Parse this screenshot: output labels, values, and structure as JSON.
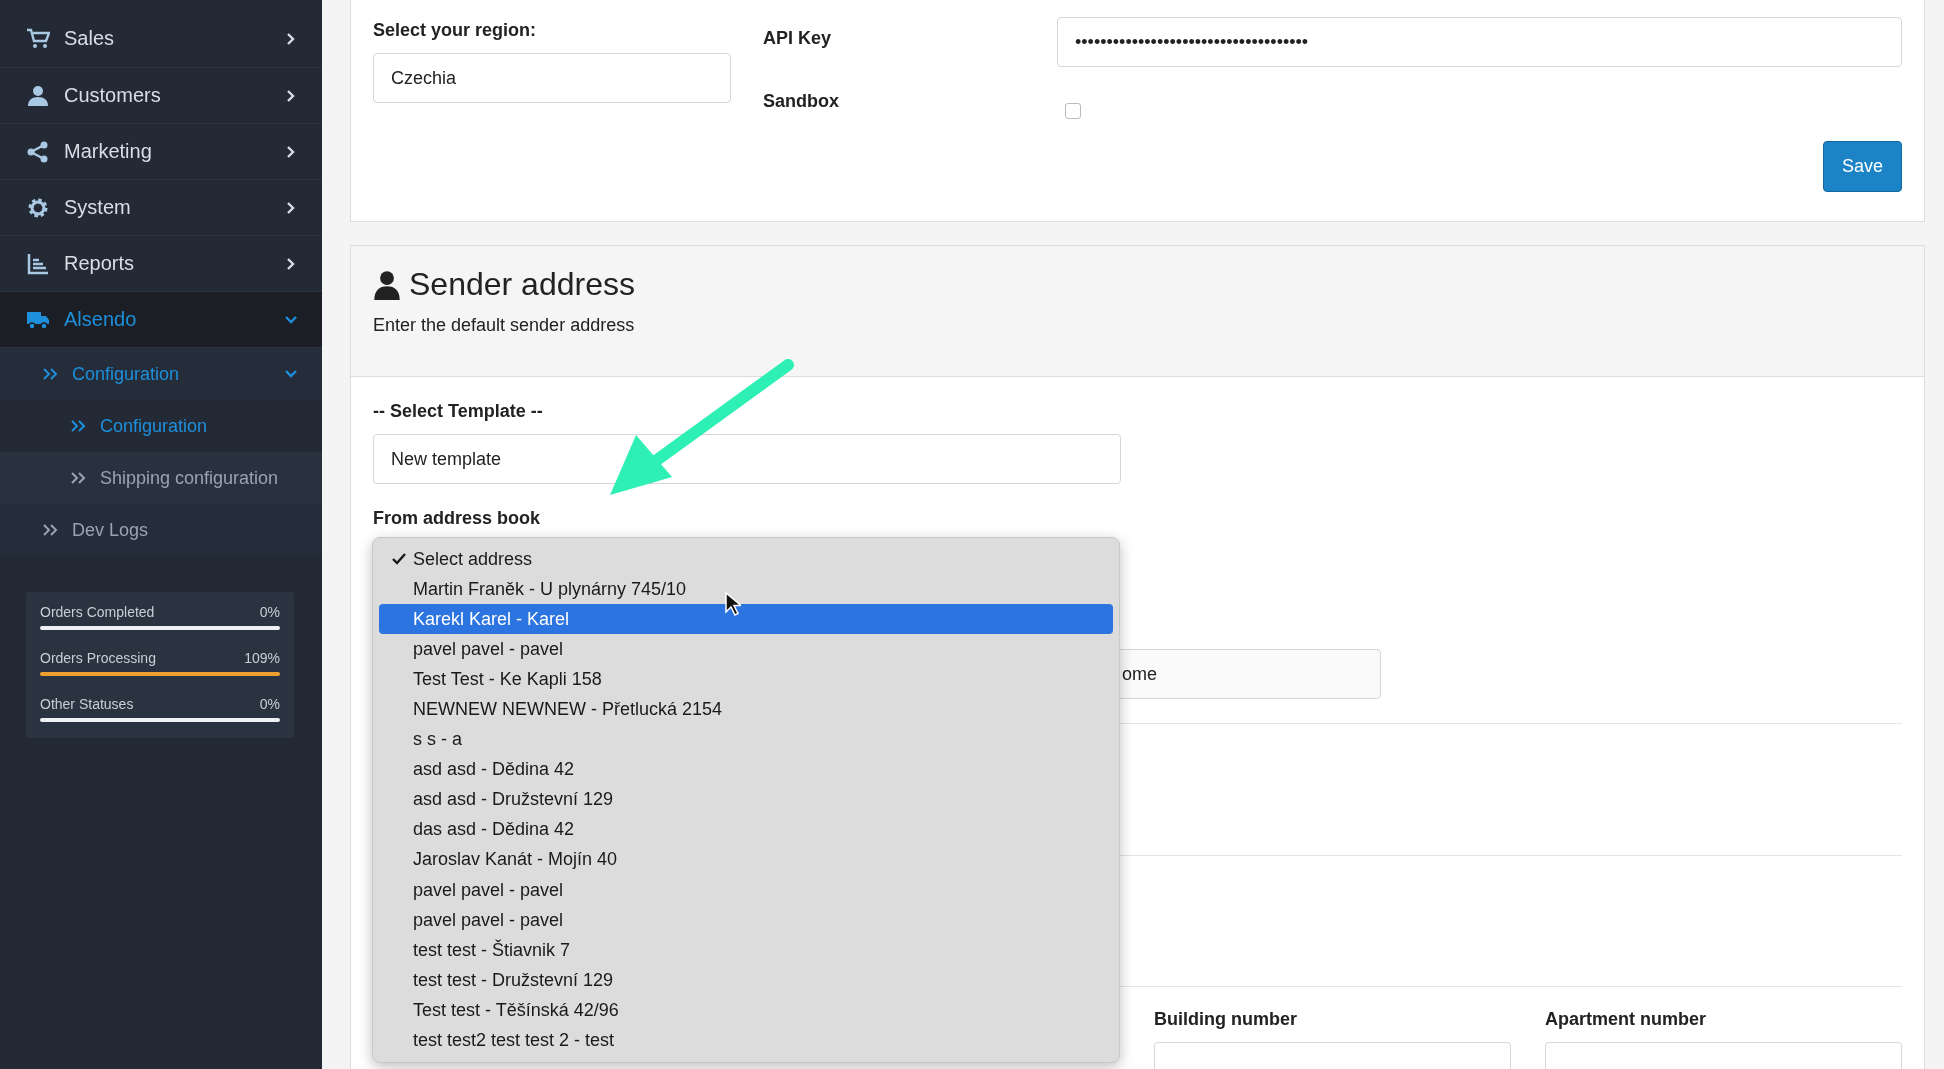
{
  "sidebar": {
    "items": [
      {
        "label": "Sales",
        "expanded": false,
        "selected": false
      },
      {
        "label": "Customers",
        "expanded": false,
        "selected": false
      },
      {
        "label": "Marketing",
        "expanded": false,
        "selected": false
      },
      {
        "label": "System",
        "expanded": false,
        "selected": false
      },
      {
        "label": "Reports",
        "expanded": false,
        "selected": false
      },
      {
        "label": "Alsendo",
        "expanded": true,
        "selected": true,
        "children": [
          {
            "label": "Configuration",
            "expanded": true,
            "selected": true,
            "children": [
              {
                "label": "Configuration",
                "selected": true
              },
              {
                "label": "Shipping configuration",
                "selected": false
              }
            ]
          },
          {
            "label": "Dev Logs",
            "selected": false
          }
        ]
      }
    ],
    "stats": [
      {
        "label": "Orders Completed",
        "value": "0%",
        "level": 0
      },
      {
        "label": "Orders Processing",
        "value": "109%",
        "level": 1
      },
      {
        "label": "Other Statuses",
        "value": "0%",
        "level": 0
      }
    ]
  },
  "settings": {
    "region_label": "Select your region:",
    "region": "Czechia",
    "api_key_label": "API Key",
    "api_key": "•••••••••••••••••••••••••••••••••••••",
    "sandbox_label": "Sandbox",
    "sandbox_checked": false,
    "save": "Save"
  },
  "sender": {
    "title": "Sender address",
    "subtitle": "Enter the default sender address",
    "template_label": "-- Select Template --",
    "template": "New template",
    "address_book_label": "From address book",
    "partial_field": "ome",
    "building_label": "Building number",
    "apartment_label": "Apartment number"
  },
  "dropdown": {
    "options": [
      {
        "label": "Select address",
        "checked": true,
        "selected": false
      },
      {
        "label": "Martin Franěk - U plynárny 745/10",
        "checked": false,
        "selected": false
      },
      {
        "label": "Karekl Karel - Karel",
        "checked": false,
        "selected": true
      },
      {
        "label": "pavel pavel - pavel",
        "checked": false,
        "selected": false
      },
      {
        "label": "Test Test - Ke Kapli 158",
        "checked": false,
        "selected": false
      },
      {
        "label": "NEWNEW NEWNEW - Přetlucká 2154",
        "checked": false,
        "selected": false
      },
      {
        "label": "s s - a",
        "checked": false,
        "selected": false
      },
      {
        "label": "asd asd - Dědina 42",
        "checked": false,
        "selected": false
      },
      {
        "label": "asd asd - Družstevní 129",
        "checked": false,
        "selected": false
      },
      {
        "label": "das asd - Dědina 42",
        "checked": false,
        "selected": false
      },
      {
        "label": "Jaroslav Kanát - Mojín 40",
        "checked": false,
        "selected": false
      },
      {
        "label": "pavel pavel - pavel",
        "checked": false,
        "selected": false
      },
      {
        "label": "pavel pavel - pavel",
        "checked": false,
        "selected": false
      },
      {
        "label": "test test - Štiavnik 7",
        "checked": false,
        "selected": false
      },
      {
        "label": "test test - Družstevní 129",
        "checked": false,
        "selected": false
      },
      {
        "label": "Test test - Těšínská 42/96",
        "checked": false,
        "selected": false
      },
      {
        "label": "test test2 test test 2 - test",
        "checked": false,
        "selected": false
      }
    ]
  }
}
